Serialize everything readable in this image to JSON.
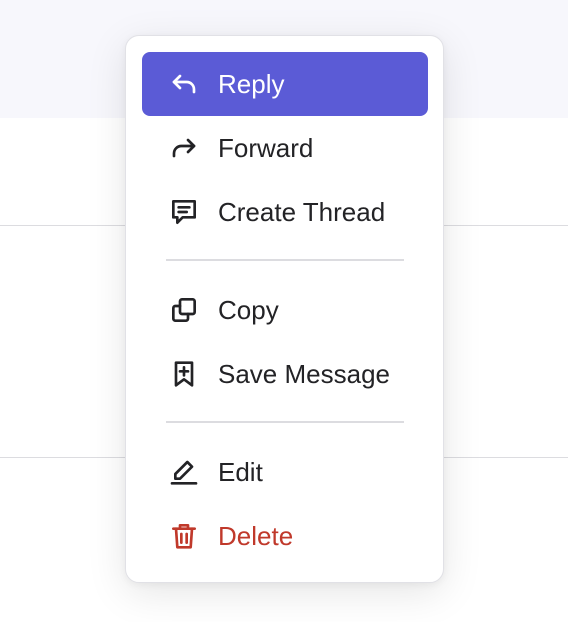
{
  "menu": {
    "items": [
      {
        "label": "Reply",
        "icon": "reply-icon",
        "state": "highlighted"
      },
      {
        "label": "Forward",
        "icon": "forward-icon"
      },
      {
        "label": "Create Thread",
        "icon": "thread-icon"
      },
      {
        "label": "Copy",
        "icon": "copy-icon"
      },
      {
        "label": "Save Message",
        "icon": "bookmark-plus-icon"
      },
      {
        "label": "Edit",
        "icon": "pencil-icon"
      },
      {
        "label": "Delete",
        "icon": "trash-icon",
        "state": "destructive"
      }
    ]
  },
  "colors": {
    "highlight": "#5b5bd6",
    "text": "#232326",
    "danger": "#c0392b"
  }
}
